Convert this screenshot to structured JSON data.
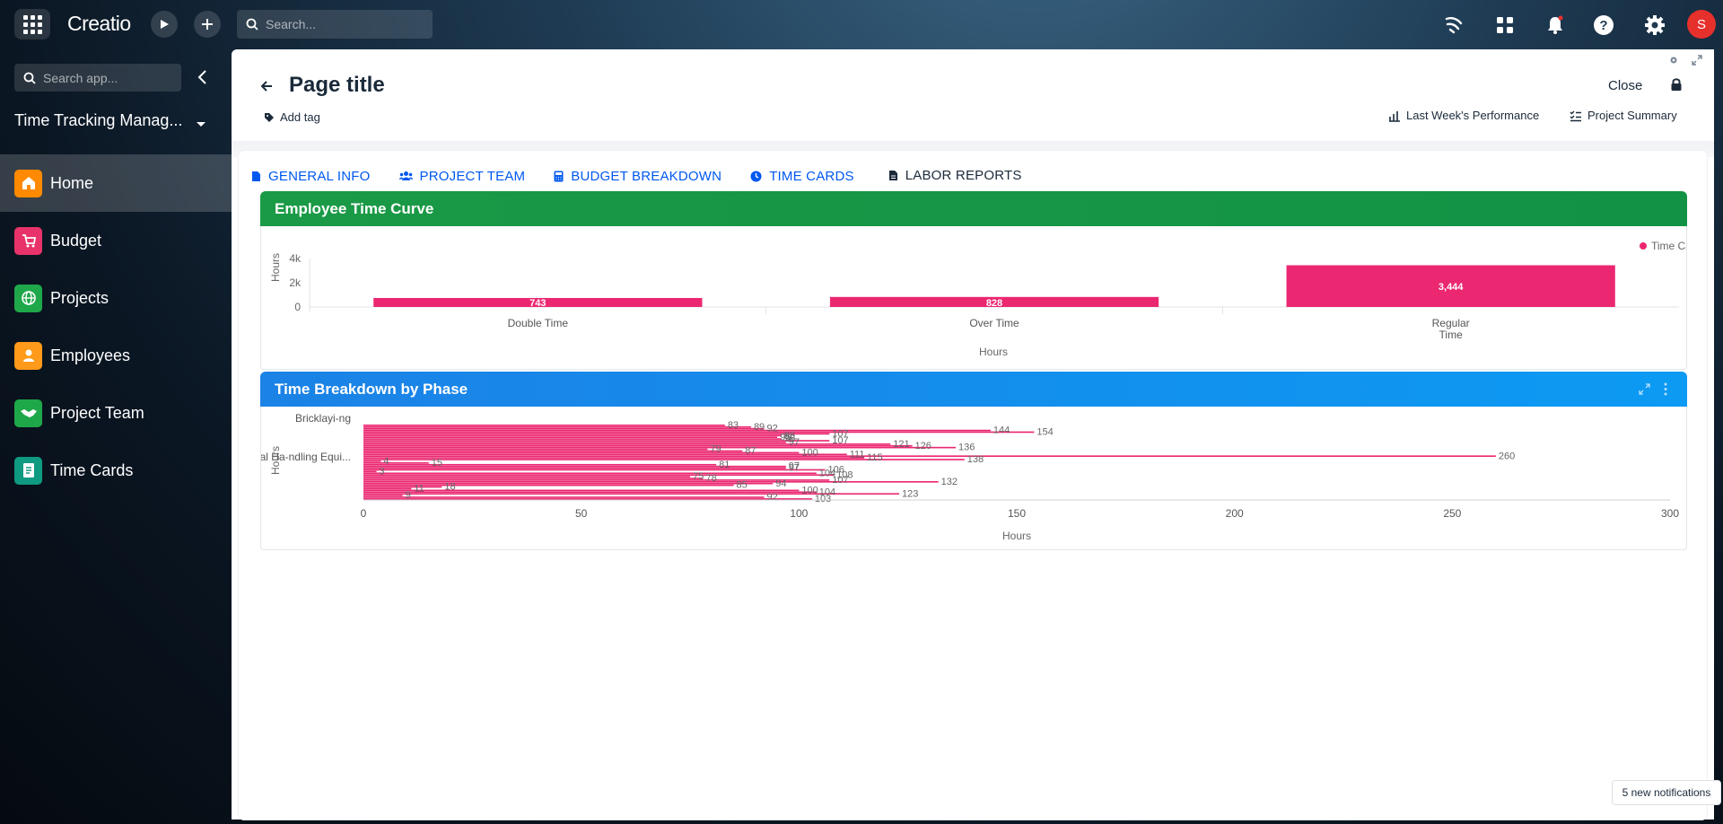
{
  "topbar": {
    "logo": "Creatio",
    "search_placeholder": "Search...",
    "avatar_initial": "S"
  },
  "sidebar": {
    "search_placeholder": "Search app...",
    "app_name": "Time Tracking Manag...",
    "items": [
      {
        "label": "Home",
        "color": "#ff8a00"
      },
      {
        "label": "Budget",
        "color": "#e8336a"
      },
      {
        "label": "Projects",
        "color": "#1fa84a"
      },
      {
        "label": "Employees",
        "color": "#ff9a1a"
      },
      {
        "label": "Project Team",
        "color": "#1fa84a"
      },
      {
        "label": "Time Cards",
        "color": "#0f9a82"
      }
    ]
  },
  "page": {
    "title": "Page title",
    "add_tag": "Add tag",
    "close": "Close",
    "links": [
      "Last Week's Performance",
      "Project Summary"
    ]
  },
  "tabs": [
    "GENERAL INFO",
    "PROJECT TEAM",
    "BUDGET BREAKDOWN",
    "TIME CARDS",
    "LABOR REPORTS"
  ],
  "panels": {
    "curve_title": "Employee Time Curve",
    "phase_title": "Time Breakdown by Phase"
  },
  "colors": {
    "accent": "#0058ef",
    "bar": "#eb2771",
    "curve_header": "#1a9a46",
    "phase_header": "#1592f0"
  },
  "chart_data": [
    {
      "type": "bar",
      "categories": [
        "Double Time",
        "Over Time",
        "Regular Time"
      ],
      "series": [
        {
          "name": "Time Card",
          "values": [
            743,
            828,
            3444
          ]
        }
      ],
      "data_labels": [
        "743",
        "828",
        "3,444"
      ],
      "ylabel": "Hours",
      "xlabel": "Hours",
      "yticks": [
        "0",
        "2k",
        "4k"
      ],
      "ylim": [
        0,
        4000
      ],
      "legend": "top-right"
    },
    {
      "type": "bar",
      "orientation": "horizontal",
      "categories_shown": [
        "Bricklayi-ng",
        "Material Ha-ndling Equi..."
      ],
      "values": [
        83,
        89,
        92,
        144,
        154,
        107,
        96,
        95,
        96,
        107,
        97,
        121,
        126,
        136,
        79,
        87,
        100,
        111,
        260,
        115,
        138,
        4,
        15,
        81,
        97,
        97,
        106,
        3,
        104,
        108,
        75,
        78,
        107,
        132,
        94,
        85,
        18,
        11,
        100,
        104,
        123,
        9,
        92,
        103
      ],
      "ylabel": "Hours",
      "xlabel": "Hours",
      "xticks": [
        "0",
        "50",
        "100",
        "150",
        "200",
        "250",
        "300"
      ],
      "xlim": [
        0,
        300
      ]
    }
  ],
  "notification": "5 new notifications"
}
